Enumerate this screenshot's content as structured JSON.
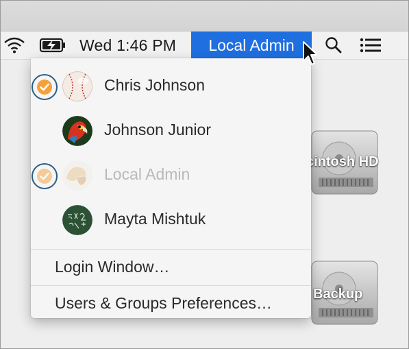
{
  "menubar": {
    "clock": "Wed 1:46 PM",
    "current_user": "Local Admin",
    "icons": [
      "wifi-icon",
      "battery-charging-icon",
      "spotlight-search-icon",
      "notification-center-icon"
    ]
  },
  "menu": {
    "users": [
      {
        "name": "Chris Johnson",
        "avatar": "baseball-avatar",
        "logged_in": true,
        "enabled": true
      },
      {
        "name": "Johnson Junior",
        "avatar": "parrot-avatar",
        "logged_in": false,
        "enabled": true
      },
      {
        "name": "Local Admin",
        "avatar": "fortune-cookie-avatar",
        "logged_in": true,
        "enabled": false
      },
      {
        "name": "Mayta Mishtuk",
        "avatar": "chalkboard-avatar",
        "logged_in": false,
        "enabled": true
      }
    ],
    "login_window": "Login Window…",
    "users_groups_prefs": "Users & Groups Preferences…"
  },
  "desktop": {
    "drives": [
      {
        "label": "cintosh HD",
        "icon": "hard-drive-icon"
      },
      {
        "label": "Backup",
        "icon": "hard-drive-icon"
      }
    ]
  },
  "colors": {
    "selection": "#1f6fe0",
    "check_orange": "#f5a03a",
    "annotation_ring": "#2b5d84"
  }
}
